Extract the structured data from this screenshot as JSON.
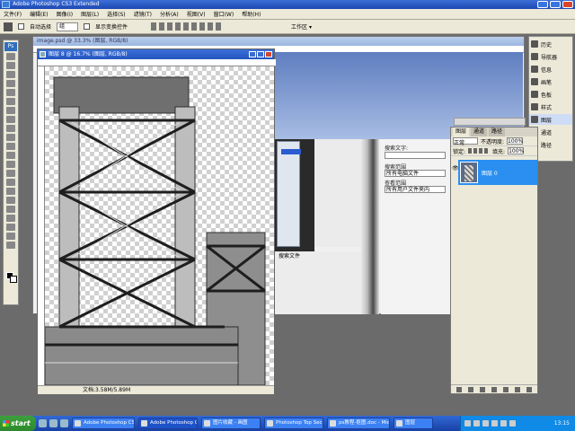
{
  "window": {
    "title": "Adobe Photoshop CS3 Extended"
  },
  "menu": [
    "文件(F)",
    "编辑(E)",
    "图像(I)",
    "图层(L)",
    "选择(S)",
    "滤镜(T)",
    "分析(A)",
    "视图(V)",
    "窗口(W)",
    "帮助(H)"
  ],
  "options": {
    "auto_select_label": "自动选择",
    "auto_select_value": "组",
    "show_transform_label": "显示变换控件",
    "workspace_label": "工作区 ▾"
  },
  "bg_document": {
    "title": "image.psd @ 33.3% (图层, RGB/8)"
  },
  "main_document": {
    "title": "图层 8 @ 16.7% (图层, RGB/8)",
    "status": "文档:3.58M/5.89M"
  },
  "form": {
    "field1_label": "搜索文字:",
    "field2_label": "搜索范围",
    "field2_value": "所有电脑文件",
    "field3_label": "查看范围",
    "field3_value": "所有用户文件夹内"
  },
  "under_panel": {
    "text": "搜索文件"
  },
  "right_panel": {
    "items": [
      {
        "label": "历史",
        "icon": "history-icon"
      },
      {
        "label": "导航器",
        "icon": "navigator-icon"
      },
      {
        "label": "信息",
        "icon": "info-icon"
      },
      {
        "label": "画笔",
        "icon": "brush-icon"
      },
      {
        "label": "色板",
        "icon": "swatches-icon"
      },
      {
        "label": "样式",
        "icon": "styles-icon"
      },
      {
        "label": "图层",
        "icon": "layers-icon",
        "selected": true
      },
      {
        "label": "通道",
        "icon": "channels-icon"
      },
      {
        "label": "路径",
        "icon": "paths-icon"
      }
    ]
  },
  "layers_panel": {
    "tabs": [
      "图层",
      "通道",
      "路径"
    ],
    "blend_mode": "正常",
    "opacity_label": "不透明度:",
    "opacity_value": "100%",
    "lock_label": "锁定:",
    "fill_label": "填充:",
    "fill_value": "100%",
    "layer_name": "图层 0"
  },
  "taskbar": {
    "start_label": "start",
    "buttons": [
      "Adobe Photoshop CS3...",
      "Adobe Photoshop CS...",
      "图片收藏 - 画图",
      "Photoshop Top Secr...",
      "ps教程-抠图.doc - Micro...",
      "图层"
    ],
    "clock": "13:15"
  },
  "colors": {
    "title_blue": "#2455c0",
    "accent_blue": "#2a8ff0",
    "start_green": "#3c9f3c"
  }
}
